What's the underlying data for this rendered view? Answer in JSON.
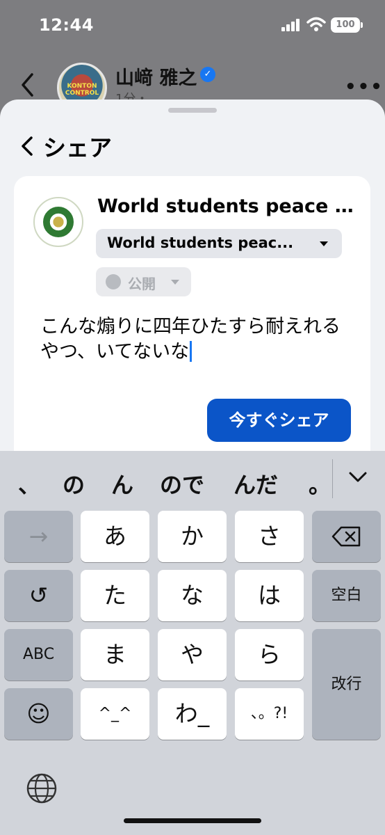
{
  "status_bar": {
    "time": "12:44",
    "battery": "100"
  },
  "background_post": {
    "author": "山﨑 雅之",
    "avatar_text": "KONTON CONTROL",
    "meta": "1分・"
  },
  "share_sheet": {
    "title": "シェア",
    "card": {
      "org_name": "World students peace f...",
      "target_select": "World students peac...",
      "privacy": "公開",
      "composer_text": "こんな煽りに四年ひたすら耐えれるやつ、いてないな",
      "share_button": "今すぐシェア"
    }
  },
  "keyboard": {
    "candidates": [
      "、",
      "の",
      "ん",
      "ので",
      "んだ",
      "。"
    ],
    "rows": [
      [
        "→",
        "あ",
        "か",
        "さ",
        "⌫"
      ],
      [
        "↺",
        "た",
        "な",
        "は",
        "空白"
      ],
      [
        "ABC",
        "ま",
        "や",
        "ら",
        "改行"
      ],
      [
        "☺",
        "^_^",
        "わ_",
        "、。?!"
      ]
    ],
    "globe_icon": "globe-icon"
  },
  "colors": {
    "accent": "#0b55c8",
    "verified": "#1877f2",
    "sheet_bg": "#f0f2f5",
    "keyboard_bg": "#d1d4da"
  }
}
